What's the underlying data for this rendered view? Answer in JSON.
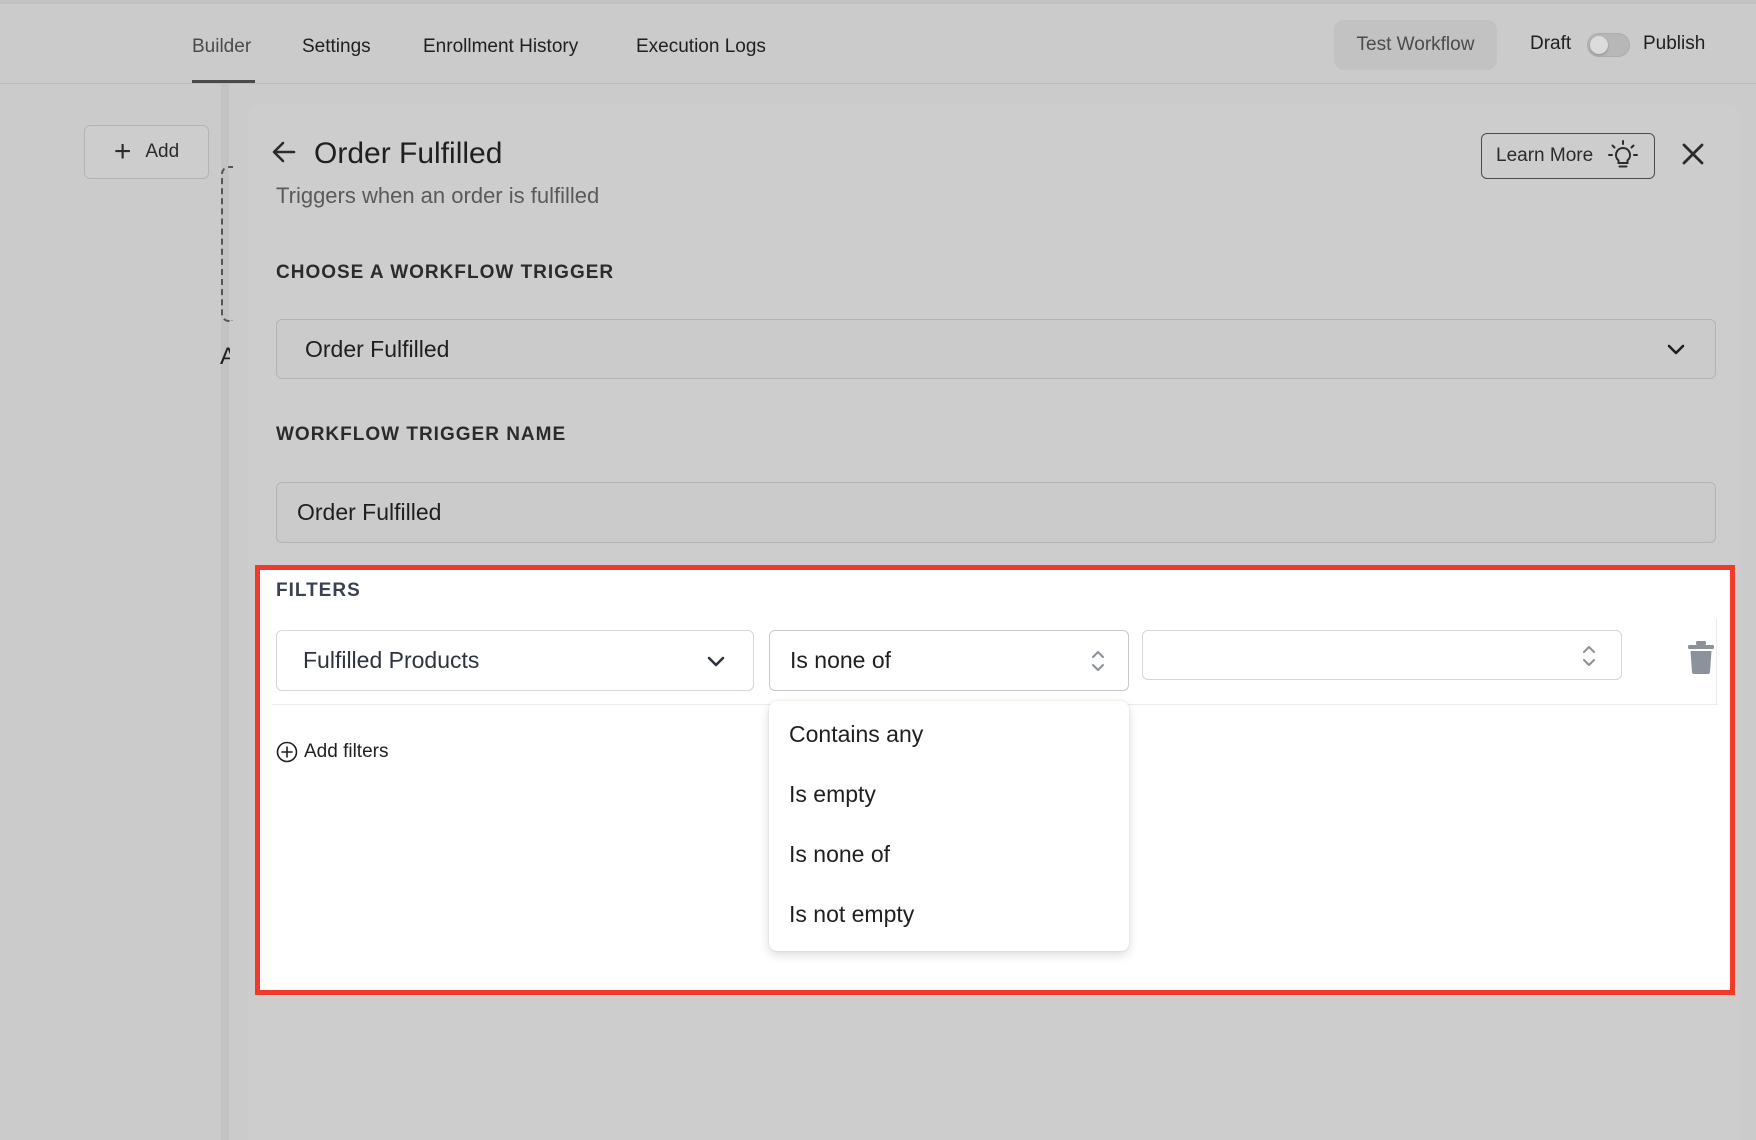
{
  "nav": {
    "tabs": [
      {
        "label": "Builder",
        "active": true
      },
      {
        "label": "Settings",
        "active": false
      },
      {
        "label": "Enrollment History",
        "active": false
      },
      {
        "label": "Execution Logs",
        "active": false
      }
    ],
    "test_workflow_label": "Test Workflow",
    "draft_label": "Draft",
    "publish_label": "Publish",
    "publish_toggle_on": false
  },
  "canvas": {
    "add_label": "Add",
    "partial_text": "A"
  },
  "panel": {
    "title": "Order Fulfilled",
    "subtitle": "Triggers when an order is fulfilled",
    "learn_more_label": "Learn More",
    "icons": {
      "back": "arrow-left-icon",
      "close": "close-icon",
      "learn": "lightbulb-icon"
    },
    "trigger_section_label": "CHOOSE A WORKFLOW TRIGGER",
    "trigger_value": "Order Fulfilled",
    "name_section_label": "WORKFLOW TRIGGER NAME",
    "name_value": "Order Fulfilled"
  },
  "filters": {
    "section_label": "FILTERS",
    "field_value": "Fulfilled Products",
    "operator_value": "Is none of",
    "value_field": "",
    "add_filters_label": "Add filters",
    "operator_options": [
      "Contains any",
      "Is empty",
      "Is none of",
      "Is not empty"
    ]
  },
  "colors": {
    "highlight_border": "#f23a2a",
    "overlay_gray": "#cbcbcb"
  }
}
